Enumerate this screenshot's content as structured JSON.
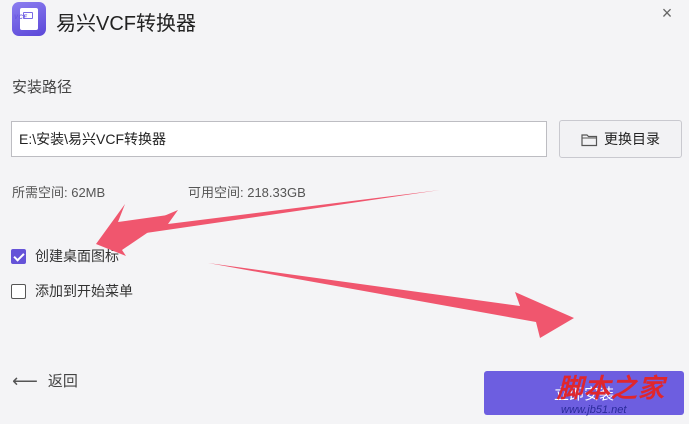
{
  "window": {
    "title": "易兴VCF转换器",
    "close_glyph": "×",
    "icon_text": "VCF"
  },
  "install_path": {
    "section_label": "安装路径",
    "value": "E:\\安装\\易兴VCF转换器",
    "change_button_label": "更换目录"
  },
  "space": {
    "required": "所需空间: 62MB",
    "available": "可用空间: 218.33GB"
  },
  "options": [
    {
      "label": "创建桌面图标",
      "checked": true
    },
    {
      "label": "添加到开始菜单",
      "checked": false
    }
  ],
  "footer": {
    "back_label": "返回",
    "install_label": "立即安装"
  },
  "watermark": {
    "main": "脚本之家",
    "sub": "www.jb51.net"
  },
  "colors": {
    "accent": "#6d5ee0",
    "annotation_arrow": "#f0566e",
    "watermark_red": "#e0262c"
  }
}
